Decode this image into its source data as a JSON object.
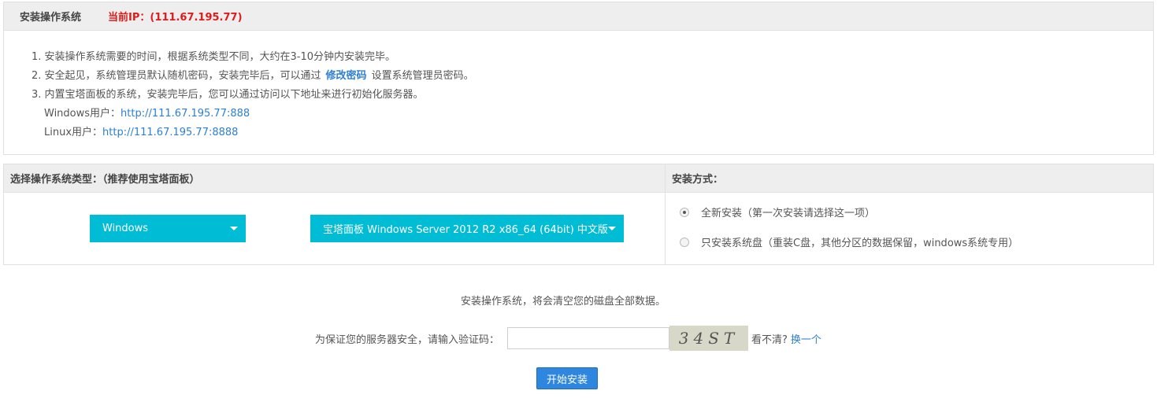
{
  "info": {
    "title": "安装操作系统",
    "current_ip": "当前IP：(111.67.195.77)",
    "note1": "1. 安装操作系统需要的时间，根据系统类型不同，大约在3-10分钟内安装完毕。",
    "note2_pre": "2. 安全起见，系统管理员默认随机密码，安装完毕后，可以通过",
    "note2_link": "修改密码",
    "note2_post": "设置系统管理员密码。",
    "note3": "3. 内置宝塔面板的系统，安装完毕后，您可以通过访问以下地址来进行初始化服务器。",
    "windows_label": "Windows用户：",
    "windows_url": "http://111.67.195.77:888",
    "linux_label": "Linux用户：",
    "linux_url": "http://111.67.195.77:8888"
  },
  "os_select": {
    "header": "选择操作系统类型：（推荐使用宝塔面板）",
    "os_value": "Windows",
    "image_value": "宝塔面板 Windows Server 2012 R2 x86_64 (64bit) 中文版"
  },
  "install_mode": {
    "header": "安装方式：",
    "options": [
      {
        "label": "全新安装（第一次安装请选择这一项）",
        "checked": true
      },
      {
        "label": "只安装系统盘（重装C盘，其他分区的数据保留，windows系统专用）",
        "checked": false
      }
    ]
  },
  "warning": "安装操作系统，将会清空您的磁盘全部数据。",
  "captcha": {
    "label": "为保证您的服务器安全，请输入验证码：",
    "input_value": "",
    "image_text": "34ST",
    "unclear": "看不清?",
    "refresh": "换一个"
  },
  "install_button": "开始安装",
  "colors": {
    "accent": "#00bcd4",
    "ip_red": "#e01b1b",
    "link_blue": "#2d7fd4",
    "button_blue": "#2e86de"
  }
}
